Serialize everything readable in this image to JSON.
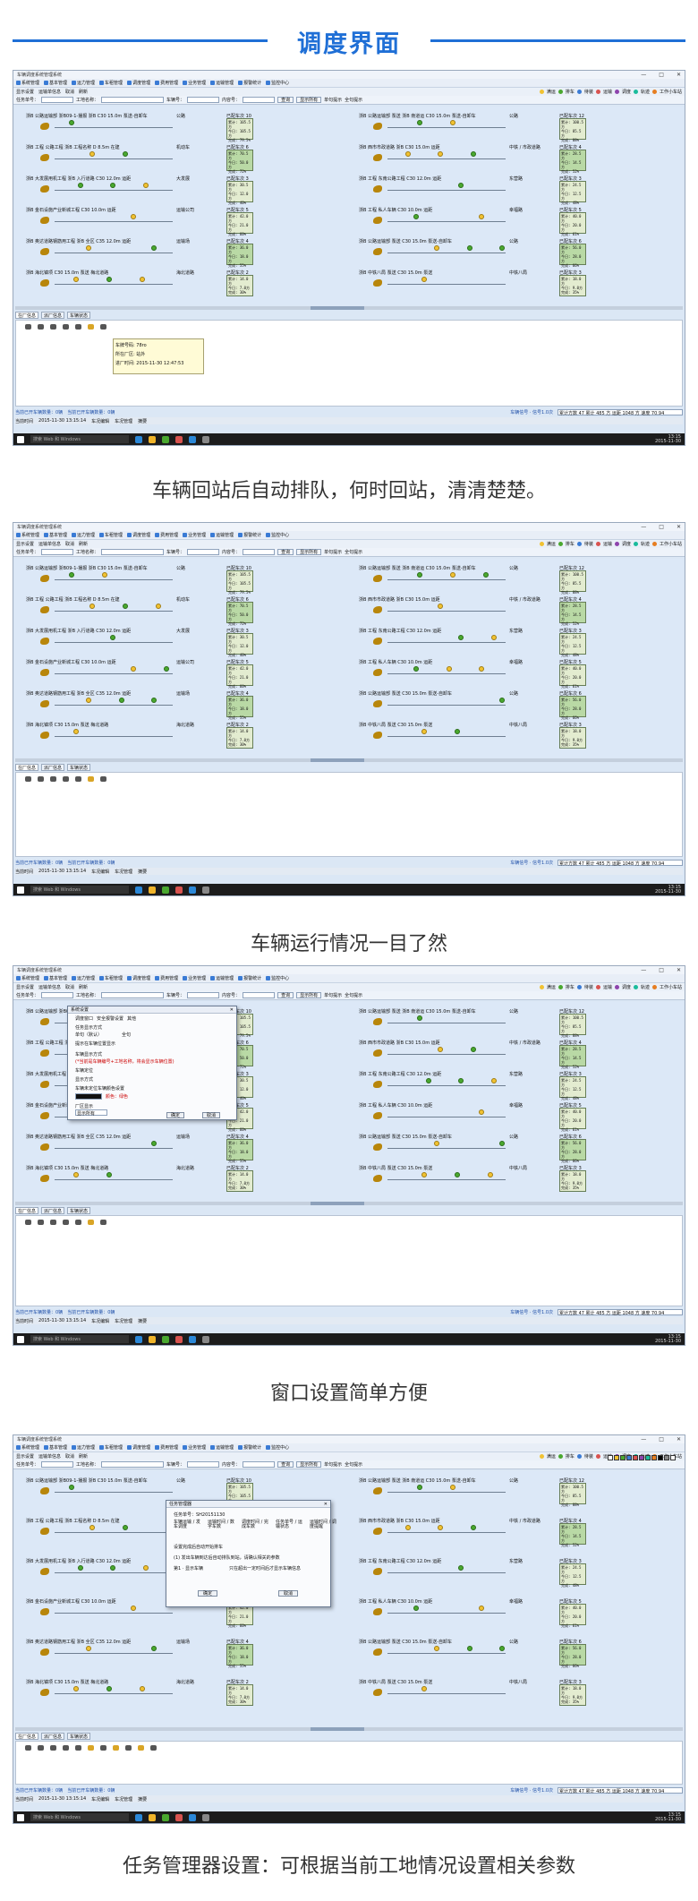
{
  "header": {
    "title": "调度界面"
  },
  "captions": [
    "车辆回站后自动排队，何时回站，清清楚楚。",
    "车辆运行情况一目了然",
    "窗口设置简单方便",
    "任务管理器设置：可根据当前工地情况设置相关参数"
  ],
  "window": {
    "title": "车辆调度系统管理系统",
    "controls": [
      "—",
      "□",
      "✕"
    ]
  },
  "menu": [
    "系统管理",
    "基本管理",
    "运力管理",
    "车租管理",
    "调度管理",
    "费用管理",
    "业务管理",
    "运输管理",
    "报警统计",
    "监控中心"
  ],
  "toolbar2": [
    "显示设置",
    "运输单信息",
    "取消",
    "刷新"
  ],
  "toolbar2_right": [
    "满运",
    "排车",
    "待装",
    "运输",
    "调度",
    "轨迹",
    "工作小车站"
  ],
  "filter": {
    "task_label": "任务单号：",
    "site_label": "工地名称：",
    "car_label": "车辆号：",
    "content_label": "内容号：",
    "query": "查询",
    "show": "显示所有",
    "radio1": "单句提示",
    "radio2": "全句提示"
  },
  "cards_left": [
    {
      "text": "浙B 公路运输部 浙B09-1-播报 浙B C30 15.0m 泵送-自卸车",
      "dest": "公路",
      "status": "已配车次 10",
      "box": [
        "累计: 105.5方",
        "今日: 105.5方",
        "完成: 79.5%"
      ]
    },
    {
      "text": "浙B 工程 公路工程 浙B 工程名称 D 8.5m 在建",
      "dest": "机动车",
      "status": "已配车次 6",
      "box": [
        "累计: 70.5方",
        "今日: 50.0方",
        "完成: 72%"
      ]
    },
    {
      "text": "浙B 大发展用机工程 浙B 入行道路 C30 12.0m 运距",
      "dest": "大发展",
      "status": "已配车次 3",
      "box": [
        "累计: 30.5方",
        "今日: 12.0方",
        "完成: 40%"
      ]
    },
    {
      "text": "浙B 金石设施产业新城工程 C30 10.0m 运距",
      "dest": "运输公司",
      "status": "已配车次 5",
      "box": [
        "累计: 42.0方",
        "今日: 21.0方",
        "完成: 60%"
      ]
    },
    {
      "text": "浙B 奥达道路钢筋用工程 浙B 全区 C35 12.0m 运距",
      "dest": "运输场",
      "status": "已配车次 4",
      "box": [
        "累计: 36.0方",
        "今日: 18.0方",
        "完成: 55%"
      ]
    },
    {
      "text": "浙B 海北镇项 C30 15.0m 泵送 梅北道路",
      "dest": "海北道路",
      "status": "已配车次 2",
      "box": [
        "累计: 14.0方",
        "今日: 7.0方",
        "完成: 30%"
      ]
    }
  ],
  "cards_right": [
    {
      "text": "浙B 公路运输部 泵送 浙B 南道运 C30 15.0m 泵送-自卸车",
      "dest": "公路",
      "status": "已配车次 12",
      "box": [
        "累计: 100.5方",
        "今日: 85.5方",
        "完成: 88%"
      ]
    },
    {
      "text": "浙B 西市市政道路 浙B C30 15.0m 运距",
      "dest": "中铁 / 市政道路",
      "status": "已配车次 4",
      "box": [
        "累计: 28.5方",
        "今日: 14.5方",
        "完成: 52%"
      ]
    },
    {
      "text": "浙B 工程 东南公路工程 C30 12.0m 运距",
      "dest": "东营路",
      "status": "已配车次 3",
      "box": [
        "累计: 24.5方",
        "今日: 12.5方",
        "完成: 48%"
      ]
    },
    {
      "text": "浙B 工程 私人车辆 C30 10.0m 运距",
      "dest": "幸福路",
      "status": "已配车次 5",
      "box": [
        "累计: 40.0方",
        "今日: 20.0方",
        "完成: 61%"
      ]
    },
    {
      "text": "浙B 公路运输部 泵送 C30 15.0m 泵送-自卸车",
      "dest": "公路",
      "status": "已配车次 6",
      "box": [
        "累计: 56.0方",
        "今日: 28.0方",
        "完成: 66%"
      ]
    },
    {
      "text": "浙B 中铁八局 泵送 C30 15.0m 泵送",
      "dest": "中铁八局",
      "status": "已配车次 3",
      "box": [
        "累计: 18.0方",
        "今日: 9.0方",
        "完成: 35%"
      ]
    }
  ],
  "bottom_tabs": [
    "在厂信息",
    "派厂信息",
    "车辆状态"
  ],
  "tooltip": {
    "line1": "车牌号码: 78ro",
    "line2": "所在厂区: 站外",
    "line3": "进厂时间: 2015-11-30 12:47:53"
  },
  "status_bar": {
    "left": "当前已开车辆数量：0辆",
    "mid": "当前已开车辆数量：0辆",
    "right": "车辆信号 · 信号1.0次",
    "summary": "累计方数 47 累计 485 方 运距 1048 方 速度 70.94"
  },
  "footer": {
    "left": "当前时间",
    "time": "2015-11-30 13:15:14",
    "f2": "车况编辑",
    "f3": "车况管理",
    "f4": "摘要"
  },
  "taskbar": {
    "search": "搜索 Web 和 Windows",
    "clock_time": "13:15",
    "clock_date": "2015-11-30"
  },
  "dialog3": {
    "title": "系统设置",
    "tabs": [
      "调度窗口",
      "安全报警设置",
      "其他"
    ],
    "l1": "任务显示方式",
    "r1": "单句（默认）",
    "r2": "全句",
    "l2": "提示在车辆位置显示",
    "l3": "车辆显示方式",
    "hint": "(*当前是车辆编号+工地名称，将会显示车辆位置)",
    "l4": "车辆定位",
    "l5": "显示方式",
    "col_label": "车辆未定位车辆颜色设置",
    "col_hint": "颜色：绿色",
    "f_label": "厂区显示",
    "sel": "显示所有",
    "ok": "确定",
    "cancel": "取消"
  },
  "dialog4": {
    "title": "任务管理器",
    "code": "任务单号：SH20151130",
    "c1": "车辆运输 / 发车调度",
    "c2": "运输时间 / 数字车数",
    "c3": "调度时间 / 完成车数",
    "c4": "任务单号 / 运输状态",
    "c5": "运输时间 / 调度提醒",
    "chk": "设置完成后自动开始排车",
    "line1": "(1) 发出车辆到达后自动排队到站，请确认相关的参数",
    "line2": "第1 · 显示车辆",
    "line3": "只在超出一定时间后才显示车辆信息",
    "ok": "确定",
    "cancel": "取消"
  },
  "colors": {
    "accent": "#1f6fd6",
    "ok": "#4aa82f",
    "warn": "#f1c232"
  }
}
